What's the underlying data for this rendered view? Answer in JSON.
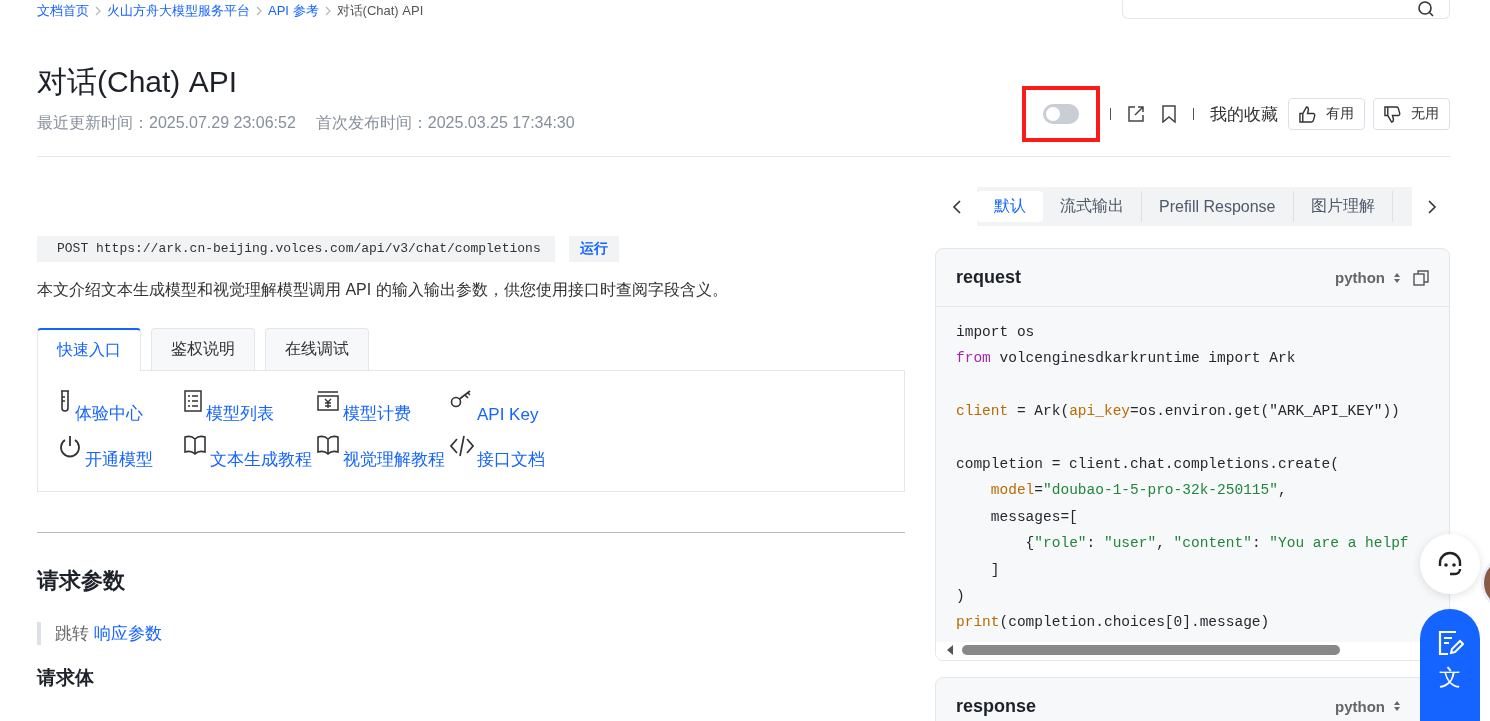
{
  "breadcrumb": [
    "文档首页",
    "火山方舟大模型服务平台",
    "API 参考",
    "对话(Chat) API"
  ],
  "title": "对话(Chat) API",
  "meta": [
    "最近更新时间：2025.07.29 23:06:52",
    "首次发布时间：2025.03.25 17:34:30"
  ],
  "toolbar": {
    "toggle_on": false,
    "highlighted": true,
    "favorites": "我的收藏",
    "useful": "有用",
    "useless": "无用"
  },
  "endpoint": {
    "method_url": "POST https://ark.cn-beijing.volces.com/api/v3/chat/completions",
    "run": "运行"
  },
  "intro": "本文介绍文本生成模型和视觉理解模型调用 API 的输入输出参数，供您使用接口时查阅字段含义。",
  "tabs": [
    {
      "label": "快速入口",
      "selected": true
    },
    {
      "label": "鉴权说明",
      "selected": false
    },
    {
      "label": "在线调试",
      "selected": false
    }
  ],
  "quick_links": [
    {
      "kind": "tube",
      "label": "体验中心"
    },
    {
      "kind": "list",
      "label": "模型列表"
    },
    {
      "kind": "bill",
      "label": "模型计费"
    },
    {
      "kind": "key",
      "label": "API Key"
    },
    {
      "kind": "power",
      "label": "开通模型"
    },
    {
      "kind": "book",
      "label": "文本生成教程"
    },
    {
      "kind": "book",
      "label": "视觉理解教程"
    },
    {
      "kind": "code",
      "label": "接口文档"
    }
  ],
  "section_title": "请求参数",
  "jump": {
    "text": "跳转",
    "link": "响应参数"
  },
  "subsection_title": "请求体",
  "example_tabs": [
    {
      "label": "默认",
      "selected": true
    },
    {
      "label": "流式输出",
      "selected": false
    },
    {
      "label": "Prefill Response",
      "selected": false
    },
    {
      "label": "图片理解",
      "selected": false
    }
  ],
  "request_card": {
    "title": "request",
    "language": "python",
    "code": [
      {
        "kind": "code",
        "tokens": [
          {
            "kind": "plain",
            "text": "import os"
          }
        ]
      },
      {
        "kind": "code",
        "tokens": [
          {
            "kind": "keyword",
            "text": "from"
          },
          {
            "kind": "plain",
            "text": " volcenginesdkarkruntime import Ark"
          }
        ]
      },
      {
        "kind": "blank"
      },
      {
        "kind": "code",
        "tokens": [
          {
            "kind": "name",
            "text": "client"
          },
          {
            "kind": "plain",
            "text": " = Ark("
          },
          {
            "kind": "name",
            "text": "api_key"
          },
          {
            "kind": "plain",
            "text": "=os.environ.get(\"ARK_API_KEY\"))"
          }
        ]
      },
      {
        "kind": "blank"
      },
      {
        "kind": "code",
        "tokens": [
          {
            "kind": "plain",
            "text": "completion = client.chat.completions.create("
          }
        ]
      },
      {
        "kind": "code",
        "tokens": [
          {
            "kind": "name",
            "text": "    model"
          },
          {
            "kind": "plain",
            "text": "="
          },
          {
            "kind": "string",
            "text": "\"doubao-1-5-pro-32k-250115\""
          },
          {
            "kind": "plain",
            "text": ","
          }
        ]
      },
      {
        "kind": "code",
        "tokens": [
          {
            "kind": "plain",
            "text": "    messages=["
          }
        ]
      },
      {
        "kind": "code",
        "tokens": [
          {
            "kind": "plain",
            "text": "        {"
          },
          {
            "kind": "string",
            "text": "\"role\""
          },
          {
            "kind": "plain",
            "text": ": "
          },
          {
            "kind": "string",
            "text": "\"user\""
          },
          {
            "kind": "plain",
            "text": ", "
          },
          {
            "kind": "string",
            "text": "\"content\""
          },
          {
            "kind": "plain",
            "text": ": "
          },
          {
            "kind": "string",
            "text": "\"You are a helpf"
          }
        ]
      },
      {
        "kind": "code",
        "tokens": [
          {
            "kind": "plain",
            "text": "    ]"
          }
        ]
      },
      {
        "kind": "code",
        "tokens": [
          {
            "kind": "plain",
            "text": ")"
          }
        ]
      },
      {
        "kind": "code",
        "tokens": [
          {
            "kind": "name",
            "text": "print"
          },
          {
            "kind": "plain",
            "text": "(completion.choices[0].message)"
          }
        ]
      }
    ]
  },
  "response_card": {
    "title": "response",
    "language": "python"
  },
  "float_button": "文"
}
